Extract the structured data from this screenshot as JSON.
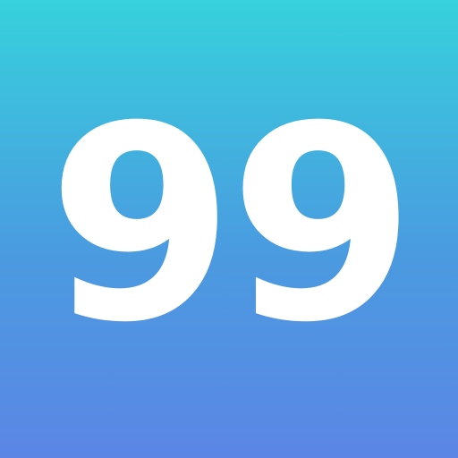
{
  "icon": {
    "label": "99",
    "colors": {
      "gradient_top": "#36D1DC",
      "gradient_bottom": "#5B86E5",
      "text": "#FFFFFF"
    }
  }
}
